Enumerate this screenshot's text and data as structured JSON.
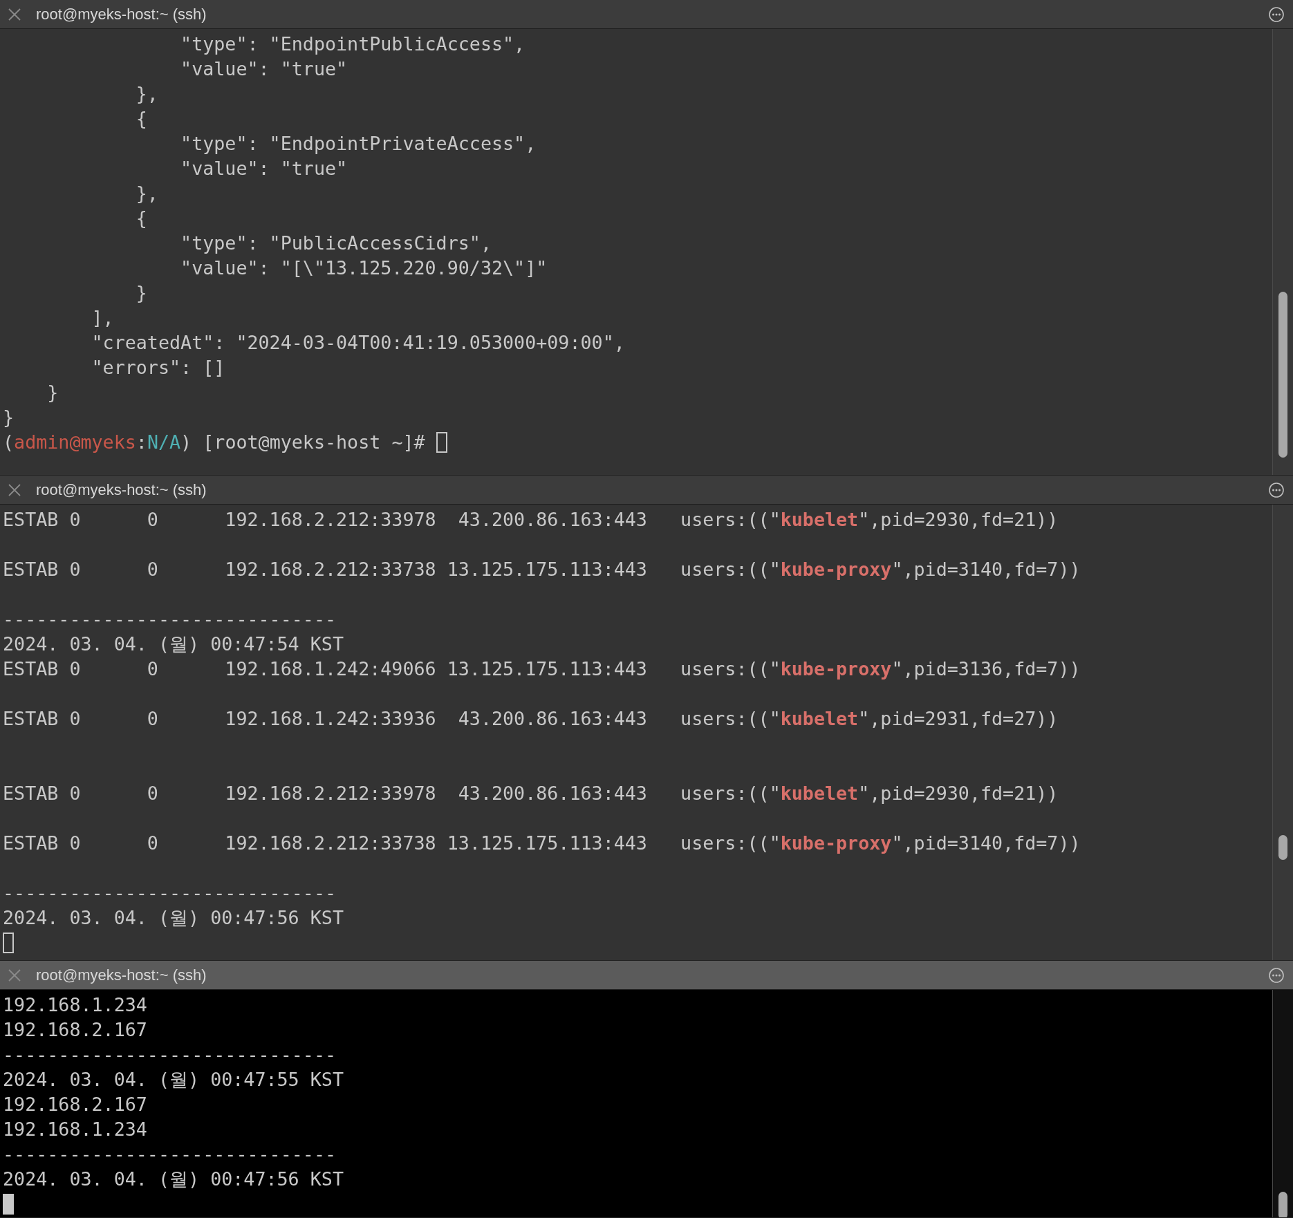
{
  "panes": [
    {
      "title": "root@myeks-host:~ (ssh)",
      "active": false,
      "lines": [
        {
          "kind": "text",
          "text": "                \"type\": \"EndpointPublicAccess\","
        },
        {
          "kind": "text",
          "text": "                \"value\": \"true\""
        },
        {
          "kind": "text",
          "text": "            },"
        },
        {
          "kind": "text",
          "text": "            {"
        },
        {
          "kind": "text",
          "text": "                \"type\": \"EndpointPrivateAccess\","
        },
        {
          "kind": "text",
          "text": "                \"value\": \"true\""
        },
        {
          "kind": "text",
          "text": "            },"
        },
        {
          "kind": "text",
          "text": "            {"
        },
        {
          "kind": "text",
          "text": "                \"type\": \"PublicAccessCidrs\","
        },
        {
          "kind": "text",
          "text": "                \"value\": \"[\\\"13.125.220.90/32\\\"]\""
        },
        {
          "kind": "text",
          "text": "            }"
        },
        {
          "kind": "text",
          "text": "        ],"
        },
        {
          "kind": "text",
          "text": "        \"createdAt\": \"2024-03-04T00:41:19.053000+09:00\","
        },
        {
          "kind": "text",
          "text": "        \"errors\": []"
        },
        {
          "kind": "text",
          "text": "    }"
        },
        {
          "kind": "text",
          "text": "}"
        },
        {
          "kind": "prompt",
          "parts": [
            {
              "kind": "plain",
              "text": "("
            },
            {
              "kind": "user",
              "text": "admin@myeks"
            },
            {
              "kind": "plain",
              "text": ":"
            },
            {
              "kind": "context",
              "text": "N/A"
            },
            {
              "kind": "plain",
              "text": ") [root@myeks-host ~]# "
            }
          ],
          "cursor": true
        }
      ]
    },
    {
      "title": "root@myeks-host:~ (ssh)",
      "active": false,
      "lines": [
        {
          "kind": "socket",
          "before": "ESTAB 0      0      192.168.2.212:33978  43.200.86.163:443   users:((\"",
          "process": "kubelet",
          "after": "\",pid=2930,fd=21))"
        },
        {
          "kind": "blank"
        },
        {
          "kind": "socket",
          "before": "ESTAB 0      0      192.168.2.212:33738 13.125.175.113:443   users:((\"",
          "process": "kube-proxy",
          "after": "\",pid=3140,fd=7))"
        },
        {
          "kind": "blank"
        },
        {
          "kind": "text",
          "text": "------------------------------"
        },
        {
          "kind": "text",
          "text": "2024. 03. 04. (월) 00:47:54 KST"
        },
        {
          "kind": "socket",
          "before": "ESTAB 0      0      192.168.1.242:49066 13.125.175.113:443   users:((\"",
          "process": "kube-proxy",
          "after": "\",pid=3136,fd=7))"
        },
        {
          "kind": "blank"
        },
        {
          "kind": "socket",
          "before": "ESTAB 0      0      192.168.1.242:33936  43.200.86.163:443   users:((\"",
          "process": "kubelet",
          "after": "\",pid=2931,fd=27))"
        },
        {
          "kind": "blank"
        },
        {
          "kind": "blank"
        },
        {
          "kind": "socket",
          "before": "ESTAB 0      0      192.168.2.212:33978  43.200.86.163:443   users:((\"",
          "process": "kubelet",
          "after": "\",pid=2930,fd=21))"
        },
        {
          "kind": "blank"
        },
        {
          "kind": "socket",
          "before": "ESTAB 0      0      192.168.2.212:33738 13.125.175.113:443   users:((\"",
          "process": "kube-proxy",
          "after": "\",pid=3140,fd=7))"
        },
        {
          "kind": "blank"
        },
        {
          "kind": "text",
          "text": "------------------------------"
        },
        {
          "kind": "text",
          "text": "2024. 03. 04. (월) 00:47:56 KST"
        },
        {
          "kind": "cursor"
        }
      ]
    },
    {
      "title": "root@myeks-host:~ (ssh)",
      "active": true,
      "lines": [
        {
          "kind": "text",
          "text": "192.168.1.234"
        },
        {
          "kind": "text",
          "text": "192.168.2.167"
        },
        {
          "kind": "text",
          "text": "------------------------------"
        },
        {
          "kind": "text",
          "text": "2024. 03. 04. (월) 00:47:55 KST"
        },
        {
          "kind": "text",
          "text": "192.168.2.167"
        },
        {
          "kind": "text",
          "text": "192.168.1.234"
        },
        {
          "kind": "text",
          "text": "------------------------------"
        },
        {
          "kind": "text",
          "text": "2024. 03. 04. (월) 00:47:56 KST"
        },
        {
          "kind": "cursor"
        }
      ]
    }
  ]
}
